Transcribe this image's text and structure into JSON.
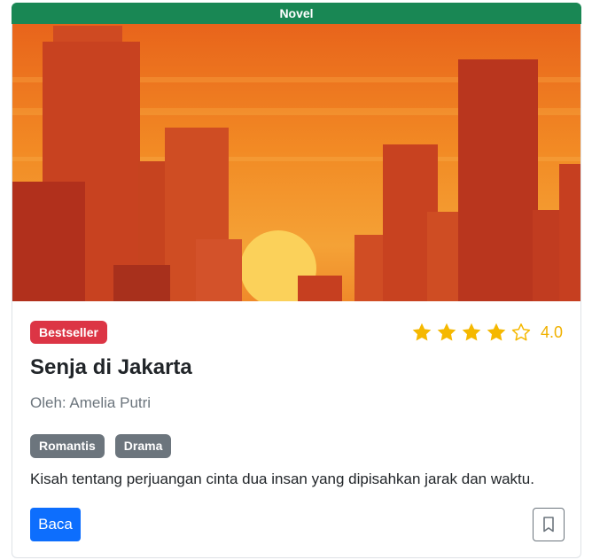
{
  "card": {
    "category": "Novel",
    "badge": "Bestseller",
    "rating": {
      "value": 4.0,
      "label": "4.0",
      "max": 5,
      "star_color": "#f5b800"
    },
    "title": "Senja di Jakarta",
    "author": "Oleh: Amelia Putri",
    "genres": [
      "Romantis",
      "Drama"
    ],
    "description": "Kisah tentang perjuangan cinta dua insan yang dipisahkan jarak dan waktu.",
    "read_button_label": "Baca",
    "bookmark_icon": "bookmark-icon",
    "colors": {
      "category_bar": "#198754",
      "badge": "#dc3545",
      "genre_tag": "#6c757d",
      "primary_button": "#0d6efd"
    }
  }
}
